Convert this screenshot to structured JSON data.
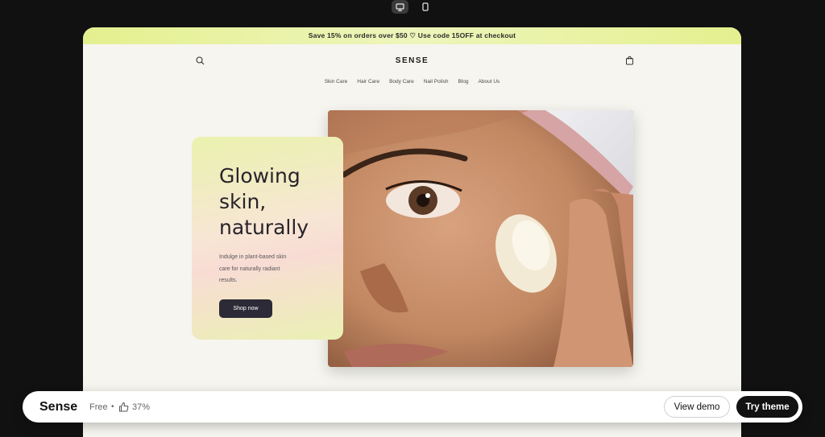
{
  "toolbar": {
    "desktop_icon": "desktop-icon",
    "mobile_icon": "mobile-icon"
  },
  "store": {
    "announcement": "Save 15% on orders over $50 ♡ Use code 15OFF at checkout",
    "logo": "SENSE",
    "nav": [
      "Skin Care",
      "Hair Care",
      "Body Care",
      "Nail Polish",
      "Blog",
      "About Us"
    ],
    "hero": {
      "title_lines": [
        "Glowing",
        "skin,",
        "naturally"
      ],
      "subtitle_lines": [
        "Indulge in plant-based skin",
        "care for naturally radiant",
        "results."
      ],
      "button": "Shop now"
    }
  },
  "bar": {
    "theme_name": "Sense",
    "price": "Free",
    "separator": "•",
    "rating": "37%",
    "view_demo": "View demo",
    "try_theme": "Try theme"
  },
  "colors": {
    "announcement_bg": "#e4f08f",
    "page_bg": "#f6f5ef",
    "button_dark": "#2b2a36",
    "outer_bg": "#121111"
  }
}
